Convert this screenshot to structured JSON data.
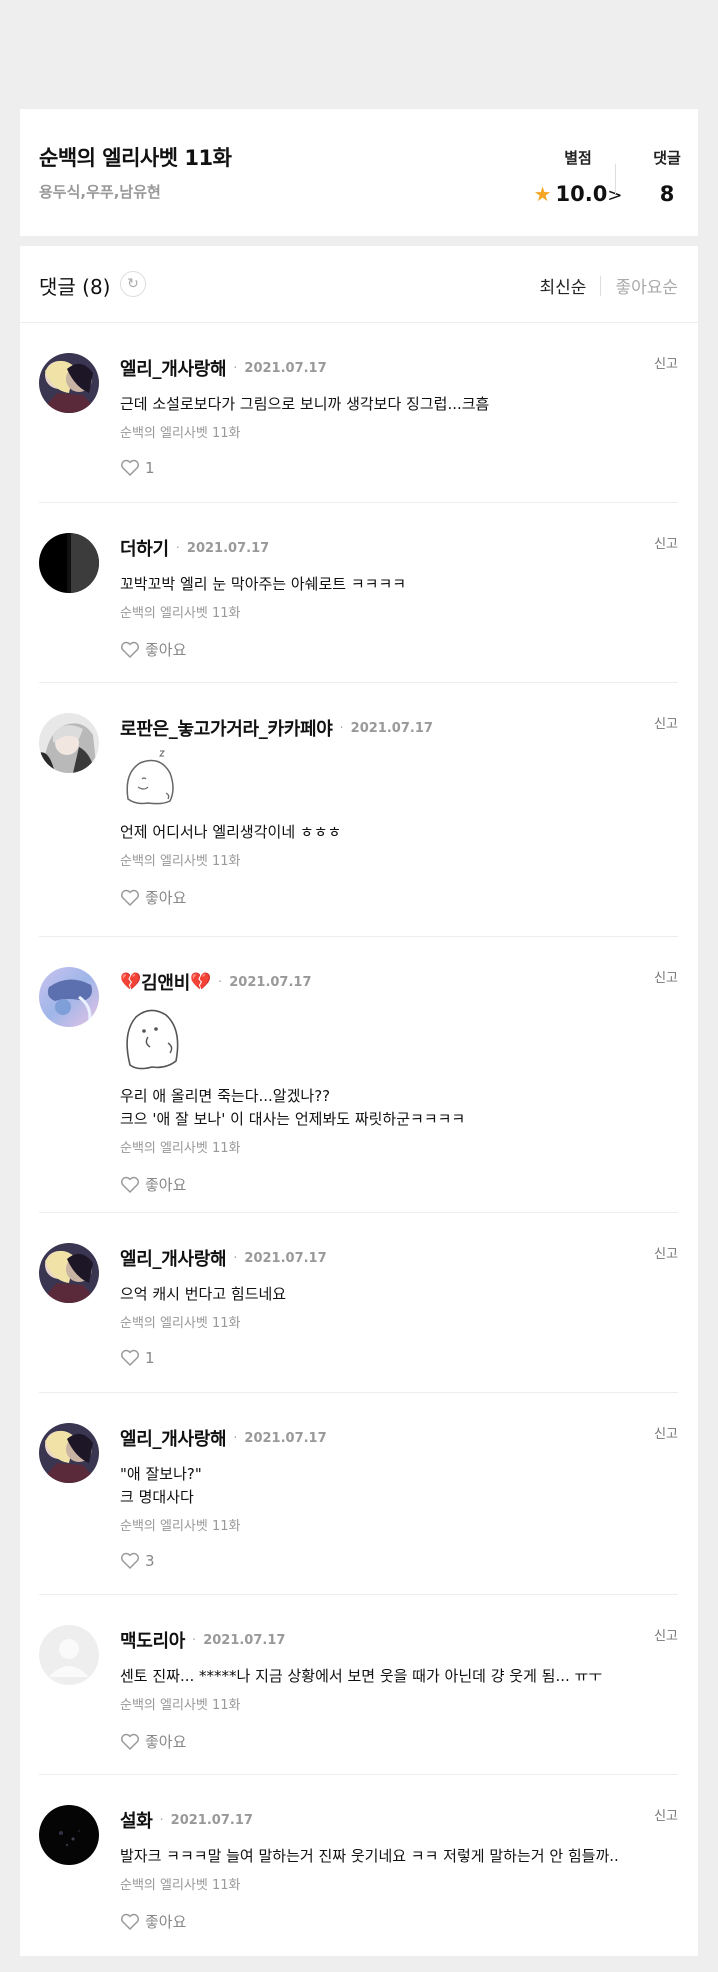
{
  "episode": {
    "title": "순백의 엘리사벳 11화",
    "authors": "용두식,우푸,남유현",
    "score_label": "별점",
    "score_value": "10.0",
    "comments_label": "댓글",
    "comments_value": "8"
  },
  "list": {
    "title": "댓글 (8)",
    "sort_latest": "최신순",
    "sort_likes": "좋아요순"
  },
  "comments": [
    {
      "nick": "엘리_개사랑해",
      "date": "2021.07.17",
      "text": "근데 소설로보다가 그림으로 보니까 생각보다 징그럽...크흠",
      "episode": "순백의 엘리사벳 11화",
      "likes": "1",
      "report": "신고"
    },
    {
      "nick": "더하기",
      "date": "2021.07.17",
      "text": "꼬박꼬박 엘리 눈 막아주는 아쉐로트 ㅋㅋㅋㅋ",
      "episode": "순백의 엘리사벳 11화",
      "likes": "좋아요",
      "report": "신고"
    },
    {
      "nick": "로판은_놓고가거라_카카페야",
      "date": "2021.07.17",
      "text": "언제 어디서나 엘리생각이네 ㅎㅎㅎ",
      "episode": "순백의 엘리사벳 11화",
      "likes": "좋아요",
      "report": "신고"
    },
    {
      "nick": "김앤비",
      "date": "2021.07.17",
      "text": "우리 애 올리면 죽는다...알겠나??\n크으 '애 잘 보나' 이 대사는 언제봐도 짜릿하군ㅋㅋㅋㅋ",
      "episode": "순백의 엘리사벳 11화",
      "likes": "좋아요",
      "report": "신고"
    },
    {
      "nick": "엘리_개사랑해",
      "date": "2021.07.17",
      "text": "으억 캐시 번다고 힘드네요",
      "episode": "순백의 엘리사벳 11화",
      "likes": "1",
      "report": "신고"
    },
    {
      "nick": "엘리_개사랑해",
      "date": "2021.07.17",
      "text": "\"애 잘보나?\"\n크 명대사다",
      "episode": "순백의 엘리사벳 11화",
      "likes": "3",
      "report": "신고"
    },
    {
      "nick": "맥도리아",
      "date": "2021.07.17",
      "text": "센토 진짜... *****나 지금 상황에서 보면 웃을 때가 아닌데 걍 웃게 됨... ㅠㅜ",
      "episode": "순백의 엘리사벳 11화",
      "likes": "좋아요",
      "report": "신고"
    },
    {
      "nick": "설화",
      "date": "2021.07.17",
      "text": "발자크 ㅋㅋㅋ말 늘여 말하는거 진짜 웃기네요 ㅋㅋ 저렇게 말하는거 안 힘들까..",
      "episode": "순백의 엘리사벳 11화",
      "likes": "좋아요",
      "report": "신고"
    }
  ],
  "colors": {
    "star": "#f5a623",
    "page_bg": "#eeeeee"
  }
}
